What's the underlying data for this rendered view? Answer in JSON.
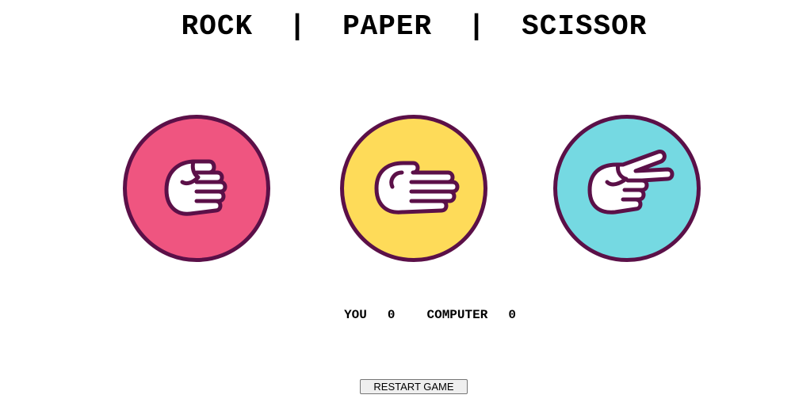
{
  "title": "ROCK  |  PAPER  |  SCISSOR",
  "choices": [
    {
      "id": "rock",
      "icon": "fist-icon",
      "color": "#ef5580"
    },
    {
      "id": "paper",
      "icon": "open-hand-icon",
      "color": "#fedb59"
    },
    {
      "id": "scissor",
      "icon": "scissor-hand-icon",
      "color": "#75d9e2"
    }
  ],
  "score": {
    "you_label": "YOU",
    "you_value": "0",
    "computer_label": "COMPUTER",
    "computer_value": "0"
  },
  "restart_label": "RESTART GAME",
  "colors": {
    "outline": "#5b1048",
    "rock": "#ef5580",
    "paper": "#fedb59",
    "scissor": "#75d9e2"
  }
}
